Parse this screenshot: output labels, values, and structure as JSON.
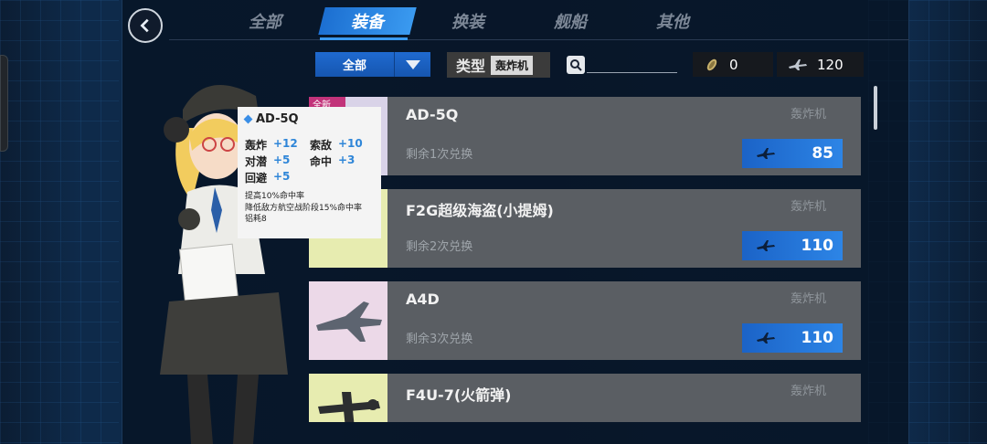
{
  "nav": {
    "tabs": [
      "全部",
      "装备",
      "换装",
      "舰船",
      "其他"
    ],
    "active_tab": "装备"
  },
  "filters": {
    "dropdown_value": "全部",
    "type_label": "类型",
    "type_value": "轰炸机",
    "search_placeholder": ""
  },
  "resources": {
    "res1_value": "0",
    "res2_value": "120"
  },
  "items": [
    {
      "name": "AD-5Q",
      "remaining": "剩余1次兑换",
      "kind": "轰炸机",
      "price": "85",
      "badge": "全新",
      "thumb_color": "#d9d3e8"
    },
    {
      "name": "F2G超级海盗(小提姆)",
      "remaining": "剩余2次兑换",
      "kind": "轰炸机",
      "price": "110",
      "thumb_color": "#e7ecb0"
    },
    {
      "name": "A4D",
      "remaining": "剩余3次兑换",
      "kind": "轰炸机",
      "price": "110",
      "thumb_color": "#ecd9e8"
    },
    {
      "name": "F4U-7(火箭弹)",
      "remaining": "",
      "kind": "轰炸机",
      "price": "",
      "thumb_color": "#e7ecb0"
    }
  ],
  "tooltip": {
    "name": "AD-5Q",
    "stats": [
      {
        "label": "轰炸",
        "value": "+12"
      },
      {
        "label": "索敌",
        "value": "+10"
      },
      {
        "label": "对潜",
        "value": "+5"
      },
      {
        "label": "命中",
        "value": "+3"
      },
      {
        "label": "回避",
        "value": "+5"
      }
    ],
    "desc": [
      "提高10%命中率",
      "降低敌方航空战阶段15%命中率",
      "铝耗8"
    ]
  },
  "colors": {
    "accent": "#2d85e6",
    "stat_value": "#2f86d8",
    "badge": "#c2337a"
  }
}
